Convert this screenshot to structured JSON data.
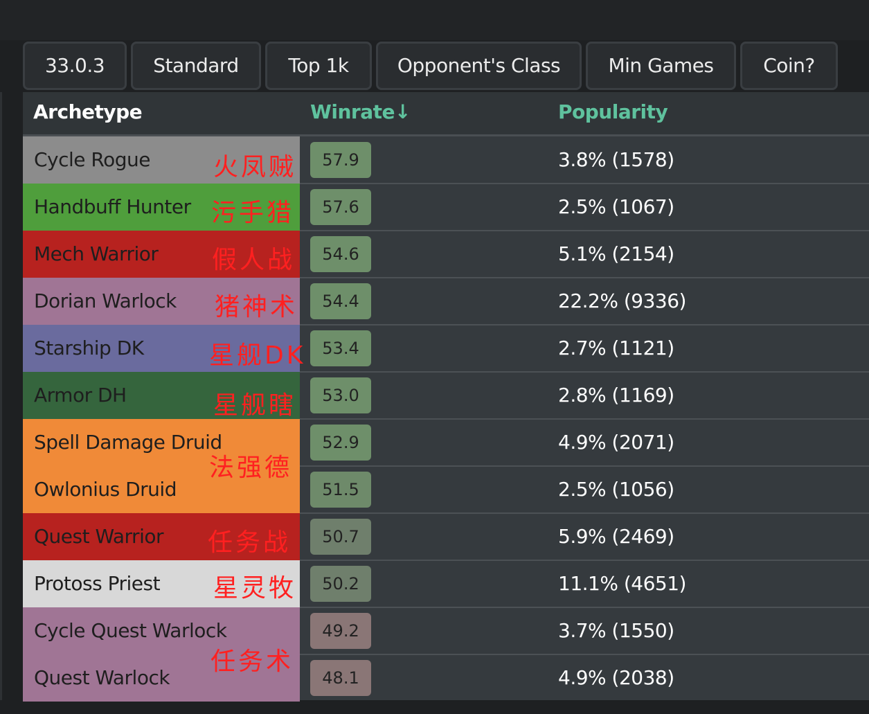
{
  "filters": [
    {
      "label": "33.0.3"
    },
    {
      "label": "Standard"
    },
    {
      "label": "Top 1k"
    },
    {
      "label": "Opponent's Class"
    },
    {
      "label": "Min Games"
    },
    {
      "label": "Coin?"
    }
  ],
  "table": {
    "headers": {
      "archetype": "Archetype",
      "winrate": "Winrate↓",
      "popularity": "Popularity"
    },
    "rows": [
      {
        "archetype": "Cycle Rogue",
        "winrate": "57.9",
        "popularity": "3.8% (1578)",
        "color": "#8c8c8c",
        "badge": "#6e8f6a"
      },
      {
        "archetype": "Handbuff Hunter",
        "winrate": "57.6",
        "popularity": "2.5% (1067)",
        "color": "#4f9e3c",
        "badge": "#6e8f6a"
      },
      {
        "archetype": "Mech Warrior",
        "winrate": "54.6",
        "popularity": "5.1% (2154)",
        "color": "#b7221f",
        "badge": "#6e8f6a"
      },
      {
        "archetype": "Dorian Warlock",
        "winrate": "54.4",
        "popularity": "22.2% (9336)",
        "color": "#a07595",
        "badge": "#6e8f6a"
      },
      {
        "archetype": "Starship DK",
        "winrate": "53.4",
        "popularity": "2.7% (1121)",
        "color": "#6a6b9e",
        "badge": "#6e8f6a"
      },
      {
        "archetype": "Armor DH",
        "winrate": "53.0",
        "popularity": "2.8% (1169)",
        "color": "#35653d",
        "badge": "#6e8f6a"
      },
      {
        "archetype": "Spell Damage Druid",
        "winrate": "52.9",
        "popularity": "4.9% (2071)",
        "color": "#f08a38",
        "badge": "#6e8f6a"
      },
      {
        "archetype": "Owlonius Druid",
        "winrate": "51.5",
        "popularity": "2.5% (1056)",
        "color": "#f08a38",
        "badge": "#6e8a6a"
      },
      {
        "archetype": "Quest Warrior",
        "winrate": "50.7",
        "popularity": "5.9% (2469)",
        "color": "#b7221f",
        "badge": "#6f7f6c"
      },
      {
        "archetype": "Protoss Priest",
        "winrate": "50.2",
        "popularity": "11.1% (4651)",
        "color": "#d8d8d8",
        "badge": "#6f7f6c"
      },
      {
        "archetype": "Cycle Quest Warlock",
        "winrate": "49.2",
        "popularity": "3.7% (1550)",
        "color": "#a07595",
        "badge": "#8a7676"
      },
      {
        "archetype": "Quest Warlock",
        "winrate": "48.1",
        "popularity": "4.9% (2038)",
        "color": "#a07595",
        "badge": "#8a7676"
      }
    ]
  },
  "annotations": [
    {
      "text": "火凤贼"
    },
    {
      "text": "污手猎"
    },
    {
      "text": "假人战"
    },
    {
      "text": "猪神术"
    },
    {
      "text": "星舰DK"
    },
    {
      "text": "星舰瞎"
    },
    {
      "text": "法强德"
    },
    {
      "text": "任务战"
    },
    {
      "text": "星灵牧"
    },
    {
      "text": "任务术"
    }
  ]
}
